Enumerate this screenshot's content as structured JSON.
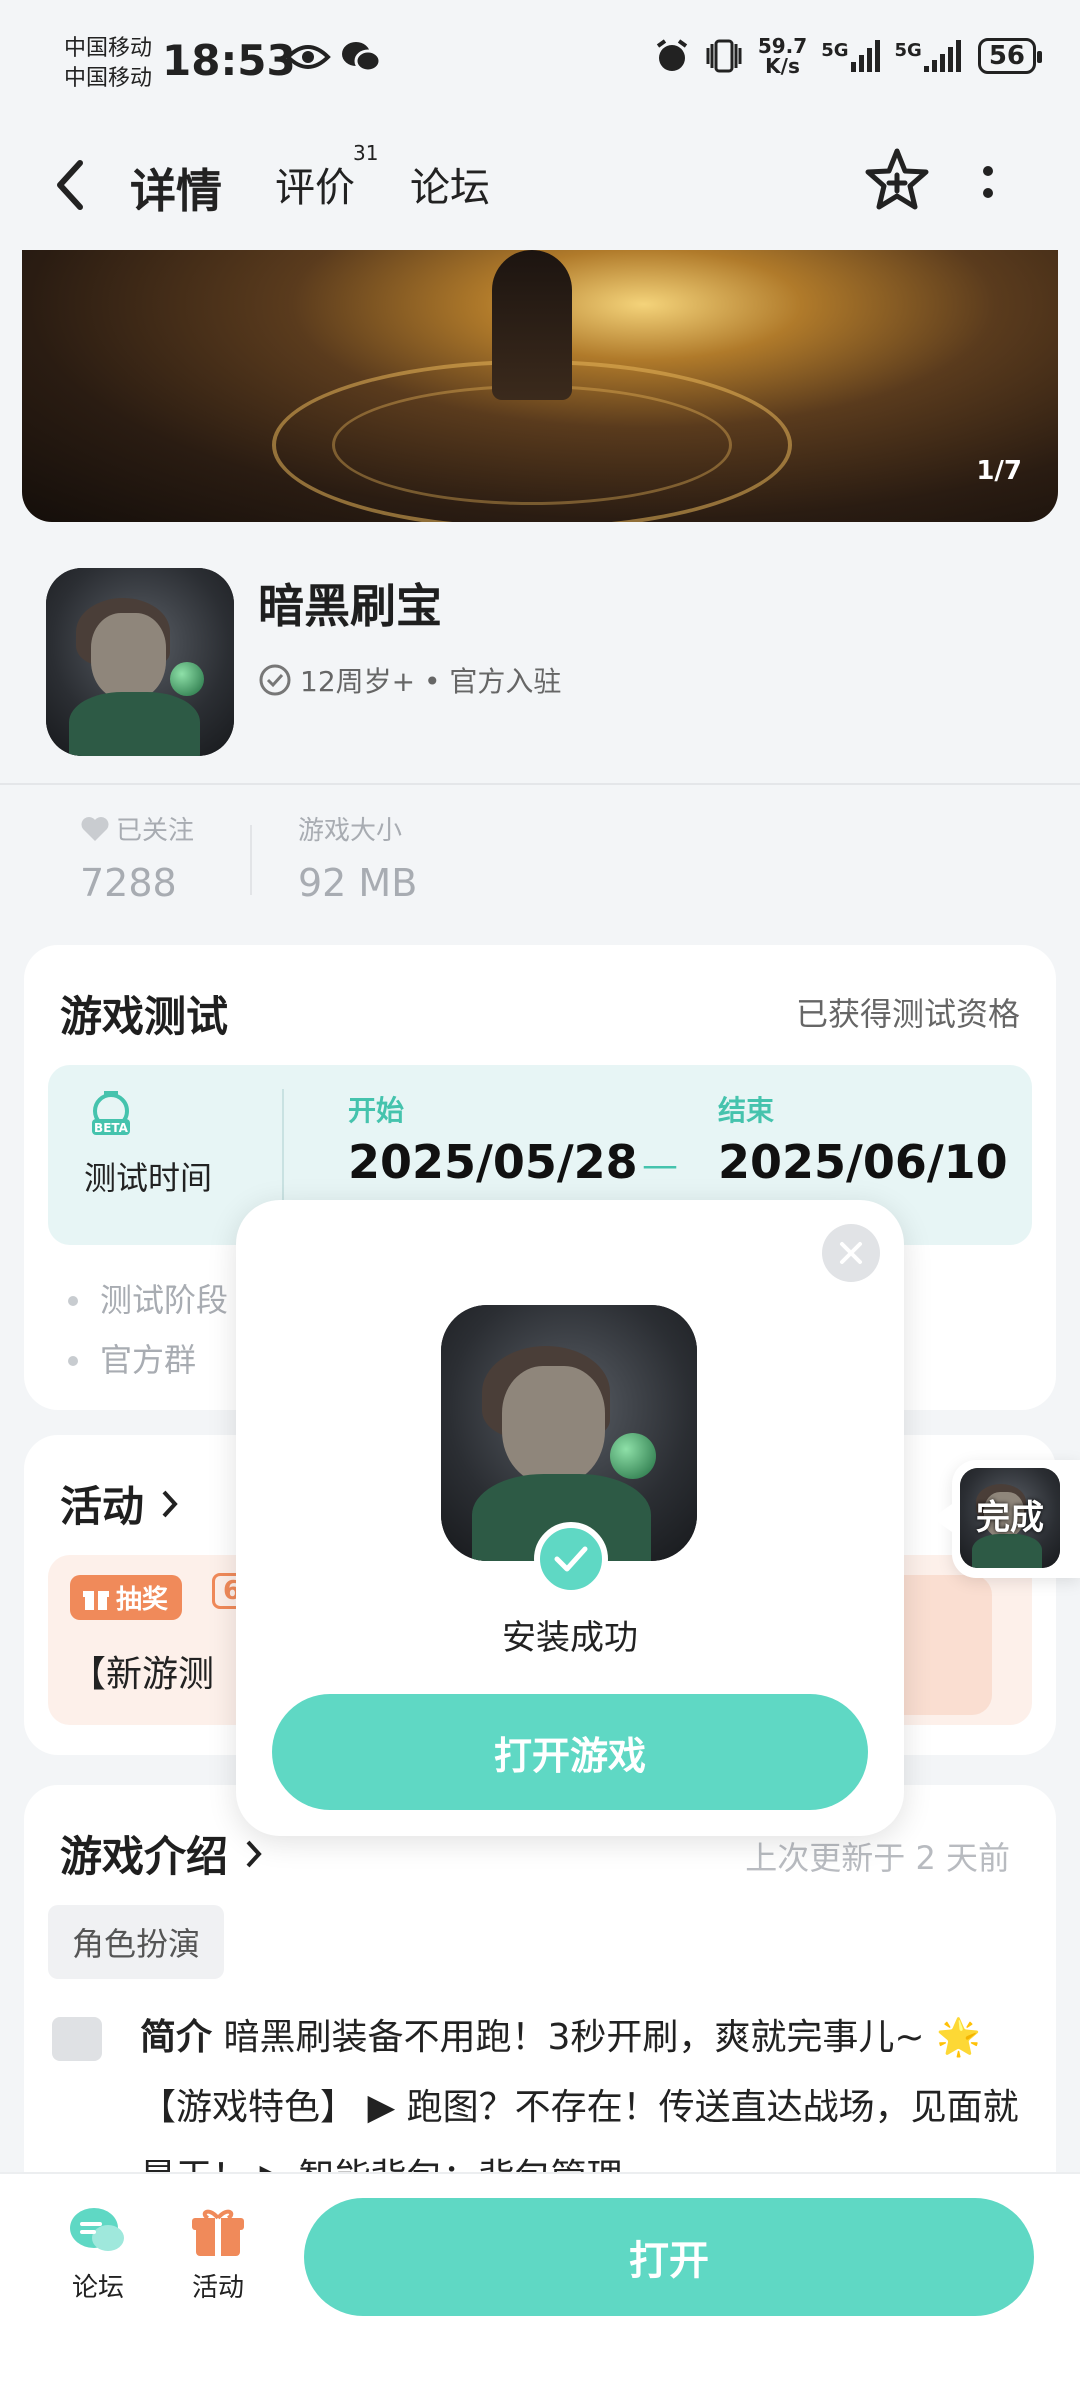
{
  "status_bar": {
    "carrier1": "中国移动",
    "carrier2": "中国移动",
    "time": "18:53",
    "net_speed_top": "59.7",
    "net_speed_unit": "K/s",
    "signal1": "5G",
    "signal2": "5G",
    "battery": "56"
  },
  "nav": {
    "tabs": [
      {
        "label": "详情",
        "active": true
      },
      {
        "label": "评价",
        "badge": "31"
      },
      {
        "label": "论坛"
      }
    ]
  },
  "banner": {
    "counter": "1/7"
  },
  "app": {
    "name": "暗黑刷宝",
    "meta": "12周岁+ • 官方入驻"
  },
  "stats": {
    "follow_label": "已关注",
    "follow_value": "7288",
    "size_label": "游戏大小",
    "size_value": "92 MB"
  },
  "test": {
    "title": "游戏测试",
    "status": "已获得测试资格",
    "badge_text": "BETA",
    "time_label": "测试时间",
    "start_label": "开始",
    "start_date": "2025/05/28",
    "end_label": "结束",
    "end_date": "2025/06/10",
    "bullets": [
      "测试阶段",
      "官方群"
    ]
  },
  "activity": {
    "title": "活动",
    "tag": "抽奖",
    "date_fragment": "6.",
    "text_fragment": "【新游测"
  },
  "intro": {
    "title": "游戏介绍",
    "updated": "上次更新于 2 天前",
    "tag": "角色扮演",
    "label": "简介",
    "text": "暗黑刷装备不用跑！3秒开刷，爽就完事儿~ 🌟 【游戏特色】 ▶ 跑图？不存在！传送直达战场，见面就是干！ ▶ 智能背包：背包管理"
  },
  "modal": {
    "message": "安装成功",
    "button": "打开游戏"
  },
  "float": {
    "label": "完成"
  },
  "bottom": {
    "forum_label": "论坛",
    "activity_label": "活动",
    "open_button": "打开"
  },
  "colors": {
    "accent": "#5fd8c4",
    "orange": "#f08a5a"
  }
}
